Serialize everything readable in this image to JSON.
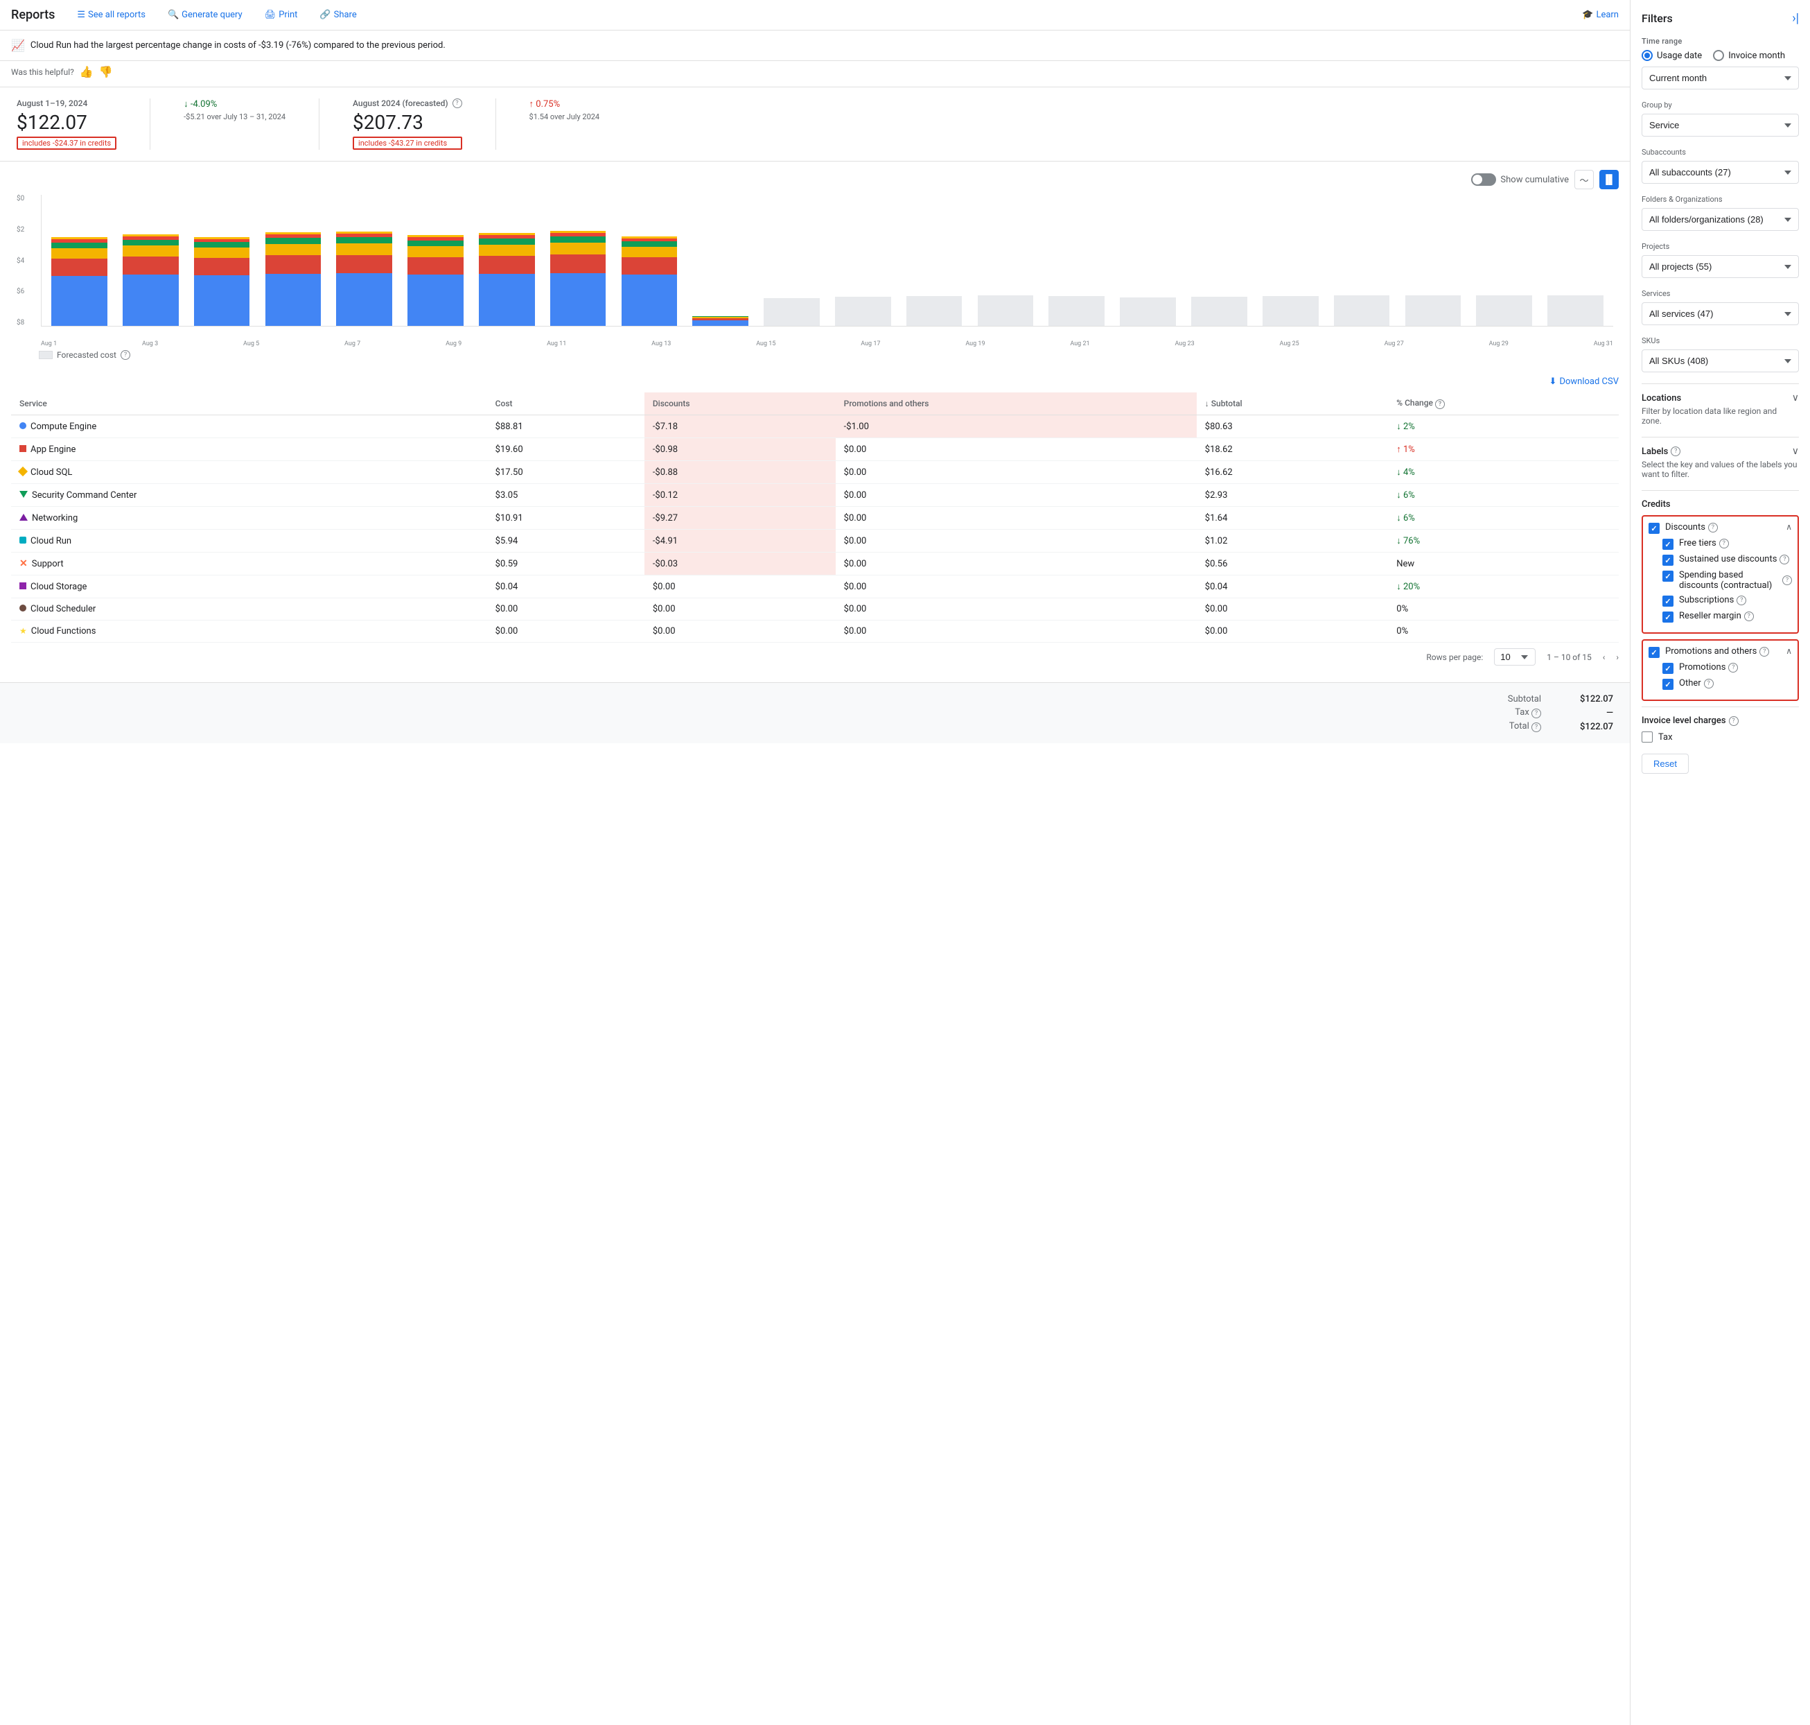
{
  "topNav": {
    "title": "Reports",
    "seeAllReports": "See all reports",
    "generateQuery": "Generate query",
    "print": "Print",
    "share": "Share",
    "learn": "Learn"
  },
  "alert": {
    "message": "Cloud Run had the largest percentage change in costs of -$3.19 (-76%) compared to the previous period.",
    "helpful": "Was this helpful?"
  },
  "stats": {
    "period1": "August 1–19, 2024",
    "amount1": "$122.07",
    "credit1": "includes -$24.37 in credits",
    "change1": "↓ -4.09%",
    "change1Sub": "-$5.21 over July 13 – 31, 2024",
    "period2": "August 2024 (forecasted)",
    "amount2": "$207.73",
    "credit2": "includes -$43.27 in credits",
    "change2": "↑ 0.75%",
    "change2Sub": "$1.54 over July 2024"
  },
  "chart": {
    "yLabels": [
      "$0",
      "$2",
      "$4",
      "$6",
      "$8"
    ],
    "xLabels": [
      "Aug 1",
      "Aug 3",
      "Aug 5",
      "Aug 7",
      "Aug 9",
      "Aug 11",
      "Aug 13",
      "Aug 15",
      "Aug 17",
      "Aug 19",
      "Aug 21",
      "Aug 23",
      "Aug 25",
      "Aug 27",
      "Aug 29",
      "Aug 31"
    ],
    "showCumulative": "Show cumulative",
    "forecastedCost": "Forecasted cost"
  },
  "table": {
    "downloadCSV": "Download CSV",
    "headers": [
      "Service",
      "Cost",
      "Discounts",
      "Promotions and others",
      "↓ Subtotal",
      "% Change"
    ],
    "rows": [
      {
        "service": "Compute Engine",
        "dot": "#4285f4",
        "shape": "circle",
        "cost": "$88.81",
        "discounts": "-$7.18",
        "promos": "-$1.00",
        "subtotal": "$80.63",
        "change": "↓ 2%",
        "changeDir": "down"
      },
      {
        "service": "App Engine",
        "dot": "#db4437",
        "shape": "square",
        "cost": "$19.60",
        "discounts": "-$0.98",
        "promos": "$0.00",
        "subtotal": "$18.62",
        "change": "↑ 1%",
        "changeDir": "up"
      },
      {
        "service": "Cloud SQL",
        "dot": "#f4b400",
        "shape": "diamond",
        "cost": "$17.50",
        "discounts": "-$0.88",
        "promos": "$0.00",
        "subtotal": "$16.62",
        "change": "↓ 4%",
        "changeDir": "down"
      },
      {
        "service": "Security Command Center",
        "dot": "#0f9d58",
        "shape": "triangle-down",
        "cost": "$3.05",
        "discounts": "-$0.12",
        "promos": "$0.00",
        "subtotal": "$2.93",
        "change": "↓ 6%",
        "changeDir": "down"
      },
      {
        "service": "Networking",
        "dot": "#7b1fa2",
        "shape": "triangle-up",
        "cost": "$10.91",
        "discounts": "-$9.27",
        "promos": "$0.00",
        "subtotal": "$1.64",
        "change": "↓ 6%",
        "changeDir": "down"
      },
      {
        "service": "Cloud Run",
        "dot": "#00acc1",
        "shape": "square-round",
        "cost": "$5.94",
        "discounts": "-$4.91",
        "promos": "$0.00",
        "subtotal": "$1.02",
        "change": "↓ 76%",
        "changeDir": "down"
      },
      {
        "service": "Support",
        "dot": "#ff7043",
        "shape": "cross",
        "cost": "$0.59",
        "discounts": "-$0.03",
        "promos": "$0.00",
        "subtotal": "$0.56",
        "change": "New",
        "changeDir": "neutral"
      },
      {
        "service": "Cloud Storage",
        "dot": "#8e24aa",
        "shape": "square",
        "cost": "$0.04",
        "discounts": "$0.00",
        "promos": "$0.00",
        "subtotal": "$0.04",
        "change": "↓ 20%",
        "changeDir": "down"
      },
      {
        "service": "Cloud Scheduler",
        "dot": "#6d4c41",
        "shape": "circle",
        "cost": "$0.00",
        "discounts": "$0.00",
        "promos": "$0.00",
        "subtotal": "$0.00",
        "change": "0%",
        "changeDir": "neutral"
      },
      {
        "service": "Cloud Functions",
        "dot": "#fdd835",
        "shape": "star",
        "cost": "$0.00",
        "discounts": "$0.00",
        "promos": "$0.00",
        "subtotal": "$0.00",
        "change": "0%",
        "changeDir": "neutral"
      }
    ],
    "pagination": {
      "rowsPerPage": "Rows per page:",
      "rowsValue": "10",
      "range": "1 – 10 of 15"
    }
  },
  "summary": {
    "subtotalLabel": "Subtotal",
    "subtotalValue": "$122.07",
    "taxLabel": "Tax",
    "taxValue": "—",
    "totalLabel": "Total",
    "totalValue": "$122.07"
  },
  "filters": {
    "title": "Filters",
    "timeRange": "Time range",
    "usageDate": "Usage date",
    "invoiceMonth": "Invoice month",
    "currentMonth": "Current month",
    "groupBy": "Group by",
    "groupByValue": "Service",
    "subaccounts": "Subaccounts",
    "subaccountsValue": "All subaccounts (27)",
    "foldersOrgs": "Folders & Organizations",
    "foldersOrgsValue": "All folders/organizations (28)",
    "projects": "Projects",
    "projectsValue": "All projects (55)",
    "services": "Services",
    "servicesValue": "All services (47)",
    "skus": "SKUs",
    "skusValue": "All SKUs (408)",
    "locations": "Locations",
    "locationsDesc": "Filter by location data like region and zone.",
    "labels": "Labels",
    "labelsDesc": "Select the key and values of the labels you want to filter.",
    "credits": "Credits",
    "discounts": "Discounts",
    "freeTiers": "Free tiers",
    "sustainedUse": "Sustained use discounts",
    "spendingBased": "Spending based discounts (contractual)",
    "subscriptions": "Subscriptions",
    "resellerMargin": "Reseller margin",
    "promotionsAndOthers": "Promotions and others",
    "promotions": "Promotions",
    "other": "Other",
    "invoiceLevelCharges": "Invoice level charges",
    "tax": "Tax",
    "resetBtn": "Reset"
  }
}
